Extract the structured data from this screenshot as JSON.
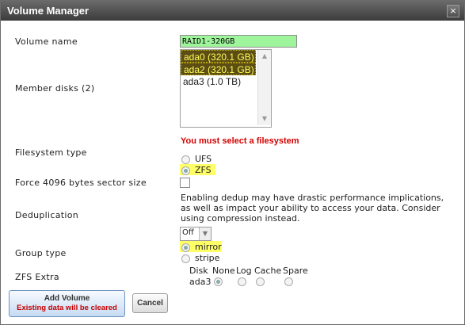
{
  "window": {
    "title": "Volume Manager",
    "close_glyph": "×"
  },
  "labels": {
    "volume_name": "Volume name",
    "member_disks": "Member disks (2)",
    "filesystem_type": "Filesystem type",
    "force_4096": "Force 4096 bytes sector size",
    "deduplication": "Deduplication",
    "group_type": "Group type",
    "zfs_extra": "ZFS Extra"
  },
  "volume_name_value": "RAID1-320GB",
  "member_disks": [
    {
      "label": "ada0 (320.1 GB)",
      "selected": true
    },
    {
      "label": "ada2 (320.1 GB)",
      "selected": true
    },
    {
      "label": "ada3 (1.0 TB)",
      "selected": false
    }
  ],
  "error_message": "You must select a filesystem",
  "filesystem_options": [
    {
      "label": "UFS",
      "checked": false
    },
    {
      "label": "ZFS",
      "checked": true
    }
  ],
  "force_4096_checked": false,
  "dedup_note": "Enabling dedup may have drastic performance implications, as well as impact your ability to access your data. Consider using compression instead.",
  "dedup_value": "Off",
  "group_type_options": [
    {
      "label": "mirror",
      "checked": true
    },
    {
      "label": "stripe",
      "checked": false
    }
  ],
  "zfs_extra": {
    "headers": [
      "Disk",
      "None",
      "Log",
      "Cache",
      "Spare"
    ],
    "rows": [
      {
        "disk": "ada3",
        "selected": "None"
      }
    ]
  },
  "buttons": {
    "add_volume": "Add Volume",
    "add_volume_warning": "Existing data will be cleared",
    "cancel": "Cancel"
  },
  "colors": {
    "name_field_bg": "#9ff59c",
    "selected_option_bg": "#5c4d14",
    "selected_option_text": "#ffff55",
    "error": "#d40000",
    "highlight": "#ffff66"
  }
}
